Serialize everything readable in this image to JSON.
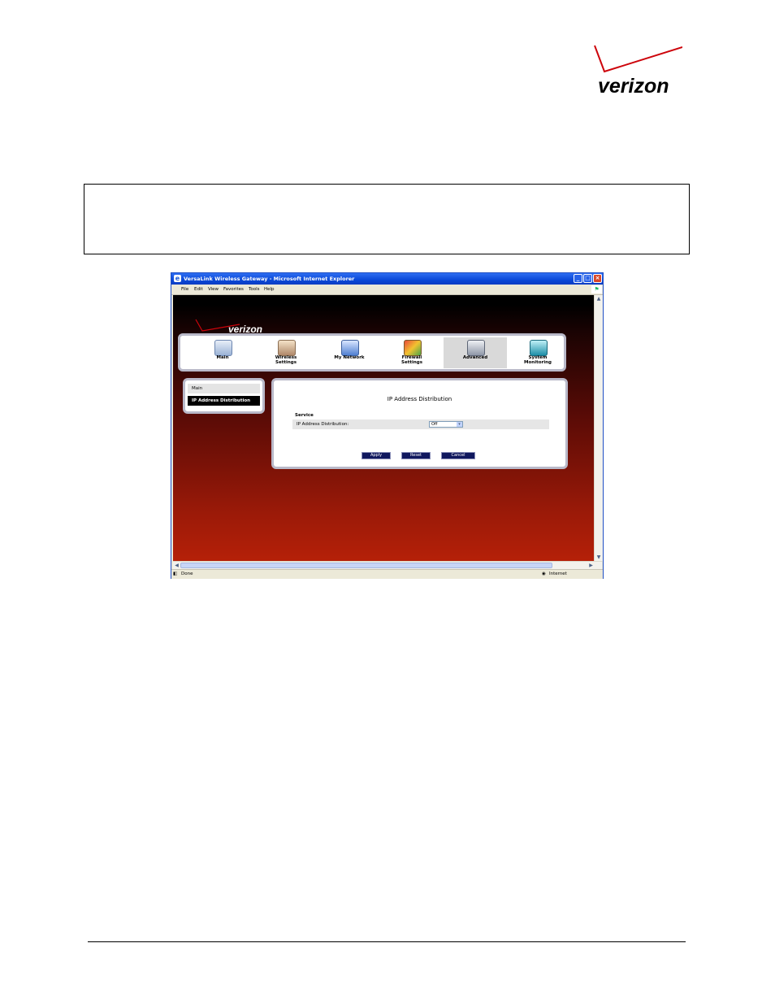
{
  "document": {
    "logo_text": "verizon"
  },
  "browser": {
    "title": "VersaLink Wireless Gateway - Microsoft Internet Explorer",
    "menu": [
      "File",
      "Edit",
      "View",
      "Favorites",
      "Tools",
      "Help"
    ],
    "status_left": "Done",
    "status_zone": "Internet"
  },
  "app": {
    "logo_text": "verizon",
    "nav": [
      {
        "label": "Main",
        "icon": "main-icon"
      },
      {
        "label": "Wireless\nSettings",
        "icon": "wireless-settings-icon"
      },
      {
        "label": "My Network",
        "icon": "my-network-icon"
      },
      {
        "label": "Firewall\nSettings",
        "icon": "firewall-settings-icon"
      },
      {
        "label": "Advanced",
        "icon": "advanced-icon",
        "active": true
      },
      {
        "label": "System\nMonitoring",
        "icon": "system-monitoring-icon"
      }
    ],
    "sidebar": {
      "items": [
        "Main",
        "IP Address Distribution"
      ],
      "selected": "IP Address Distribution"
    },
    "main": {
      "title": "IP Address Distribution",
      "section": "Service",
      "field_label": "IP Address Distribution:",
      "field_value": "Off",
      "buttons": {
        "apply": "Apply",
        "reset": "Reset",
        "cancel": "Cancel"
      }
    }
  },
  "colors": {
    "verizon_red": "#cd040b",
    "nav_border": "#b9b9c9",
    "button_bg": "#10185e"
  }
}
